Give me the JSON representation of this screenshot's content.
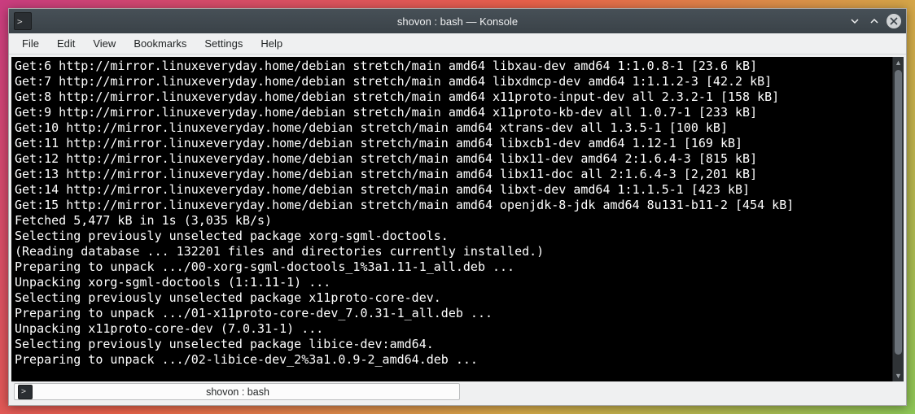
{
  "window": {
    "title": "shovon : bash — Konsole"
  },
  "menubar": {
    "file": "File",
    "edit": "Edit",
    "view": "View",
    "bookmarks": "Bookmarks",
    "settings": "Settings",
    "help": "Help"
  },
  "terminal": {
    "lines": [
      "Get:6 http://mirror.linuxeveryday.home/debian stretch/main amd64 libxau-dev amd64 1:1.0.8-1 [23.6 kB]",
      "Get:7 http://mirror.linuxeveryday.home/debian stretch/main amd64 libxdmcp-dev amd64 1:1.1.2-3 [42.2 kB]",
      "Get:8 http://mirror.linuxeveryday.home/debian stretch/main amd64 x11proto-input-dev all 2.3.2-1 [158 kB]",
      "Get:9 http://mirror.linuxeveryday.home/debian stretch/main amd64 x11proto-kb-dev all 1.0.7-1 [233 kB]",
      "Get:10 http://mirror.linuxeveryday.home/debian stretch/main amd64 xtrans-dev all 1.3.5-1 [100 kB]",
      "Get:11 http://mirror.linuxeveryday.home/debian stretch/main amd64 libxcb1-dev amd64 1.12-1 [169 kB]",
      "Get:12 http://mirror.linuxeveryday.home/debian stretch/main amd64 libx11-dev amd64 2:1.6.4-3 [815 kB]",
      "Get:13 http://mirror.linuxeveryday.home/debian stretch/main amd64 libx11-doc all 2:1.6.4-3 [2,201 kB]",
      "Get:14 http://mirror.linuxeveryday.home/debian stretch/main amd64 libxt-dev amd64 1:1.1.5-1 [423 kB]",
      "Get:15 http://mirror.linuxeveryday.home/debian stretch/main amd64 openjdk-8-jdk amd64 8u131-b11-2 [454 kB]",
      "Fetched 5,477 kB in 1s (3,035 kB/s)",
      "Selecting previously unselected package xorg-sgml-doctools.",
      "(Reading database ... 132201 files and directories currently installed.)",
      "Preparing to unpack .../00-xorg-sgml-doctools_1%3a1.11-1_all.deb ...",
      "Unpacking xorg-sgml-doctools (1:1.11-1) ...",
      "Selecting previously unselected package x11proto-core-dev.",
      "Preparing to unpack .../01-x11proto-core-dev_7.0.31-1_all.deb ...",
      "Unpacking x11proto-core-dev (7.0.31-1) ...",
      "Selecting previously unselected package libice-dev:amd64.",
      "Preparing to unpack .../02-libice-dev_2%3a1.0.9-2_amd64.deb ..."
    ]
  },
  "tab": {
    "label": "shovon : bash"
  }
}
